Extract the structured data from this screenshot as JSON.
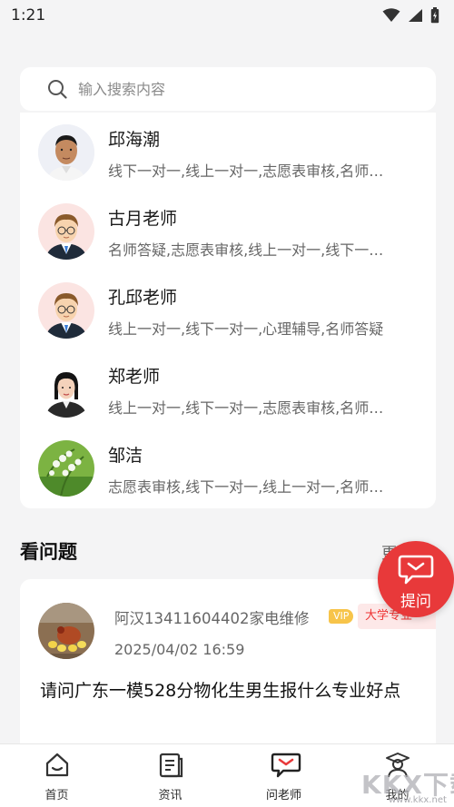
{
  "status_bar": {
    "time": "1:21"
  },
  "search": {
    "placeholder": "输入搜索内容"
  },
  "teachers": [
    {
      "name": "邱海潮",
      "tags": "线下一对一,线上一对一,志愿表审核,名师…"
    },
    {
      "name": "古月老师",
      "tags": "名师答疑,志愿表审核,线上一对一,线下一…"
    },
    {
      "name": "孔邱老师",
      "tags": "线上一对一,线下一对一,心理辅导,名师答疑"
    },
    {
      "name": "郑老师",
      "tags": "线上一对一,线下一对一,志愿表审核,名师…"
    },
    {
      "name": "邹洁",
      "tags": "志愿表审核,线下一对一,线上一对一,名师…"
    }
  ],
  "questions_section": {
    "title": "看问题",
    "more": "更多"
  },
  "question": {
    "user": "阿汉13411604402家电维修",
    "vip": "VIP",
    "major_badge": "大学专业",
    "date": "2025/04/02 16:59",
    "text": "请问广东一模528分物化生男生报什么专业好点"
  },
  "ask_button": {
    "label": "提问"
  },
  "tabs": [
    {
      "label": "首页",
      "icon": "home-icon"
    },
    {
      "label": "资讯",
      "icon": "news-icon"
    },
    {
      "label": "问老师",
      "icon": "ask-teacher-icon"
    },
    {
      "label": "我的",
      "icon": "profile-icon"
    }
  ],
  "watermark": {
    "text": "KKX下载",
    "url": "www.kkx.net"
  },
  "colors": {
    "accent": "#e8393a",
    "background": "#f4f4f5",
    "card": "#ffffff",
    "vip": "#f7c44a"
  }
}
